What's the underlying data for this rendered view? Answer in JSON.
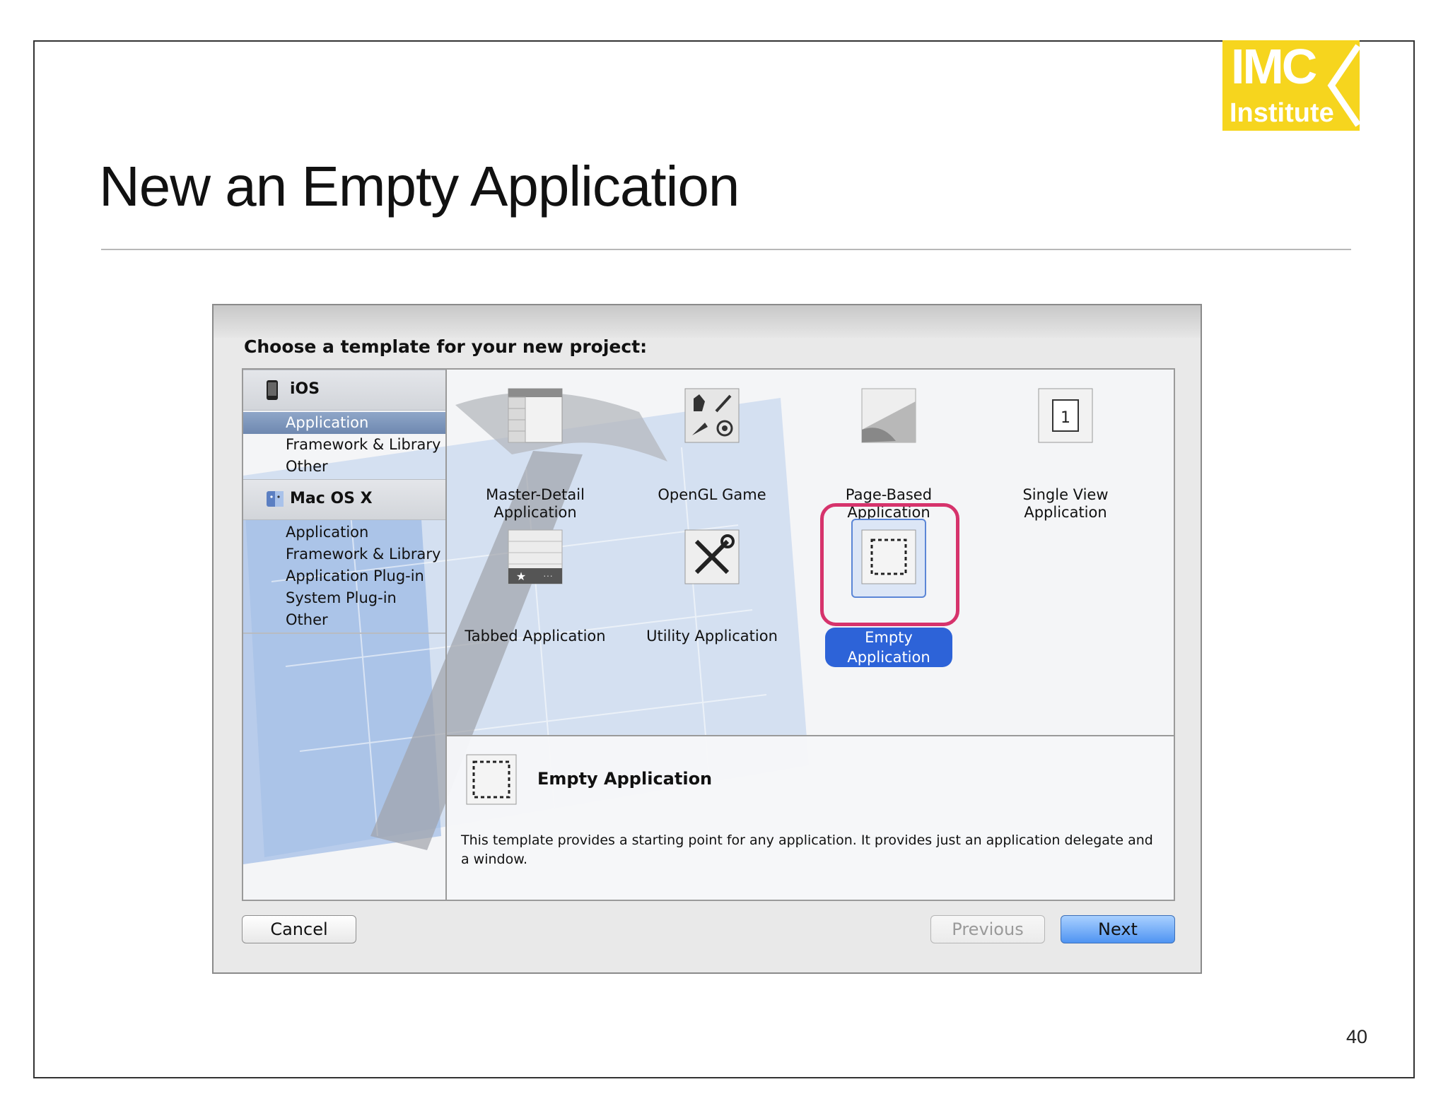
{
  "slide": {
    "title": "New an Empty Application",
    "page_number": "40",
    "logo": {
      "line1": "IMC",
      "line2": "Institute",
      "color": "#f6d51e"
    }
  },
  "dialog": {
    "prompt": "Choose a template for your new project:",
    "sidebar": {
      "ios": {
        "label": "iOS",
        "icon": "iphone-icon",
        "items": [
          "Application",
          "Framework & Library",
          "Other"
        ],
        "selected": "Application"
      },
      "macos": {
        "label": "Mac OS X",
        "icon": "mac-finder-icon",
        "items": [
          "Application",
          "Framework & Library",
          "Application Plug-in",
          "System Plug-in",
          "Other"
        ]
      }
    },
    "templates": [
      {
        "name_line1": "Master-Detail",
        "name_line2": "Application",
        "icon": "master-detail-icon"
      },
      {
        "name_line1": "OpenGL Game",
        "name_line2": "",
        "icon": "opengl-game-icon"
      },
      {
        "name_line1": "Page-Based",
        "name_line2": "Application",
        "icon": "page-curl-icon"
      },
      {
        "name_line1": "Single View",
        "name_line2": "Application",
        "icon": "single-view-icon"
      },
      {
        "name_line1": "Tabbed Application",
        "name_line2": "",
        "icon": "tabbed-icon"
      },
      {
        "name_line1": "Utility Application",
        "name_line2": "",
        "icon": "utility-tools-icon"
      },
      {
        "name_line1": "Empty Application",
        "name_line2": "",
        "icon": "empty-app-icon"
      }
    ],
    "selected_template": "Empty Application",
    "detail": {
      "title": "Empty Application",
      "description": "This template provides a starting point for any application. It provides just an application delegate and a window."
    },
    "buttons": {
      "cancel": "Cancel",
      "previous": "Previous",
      "next": "Next"
    },
    "colors": {
      "selection": "#2d63d8",
      "highlight_ring": "#d6336c"
    }
  }
}
